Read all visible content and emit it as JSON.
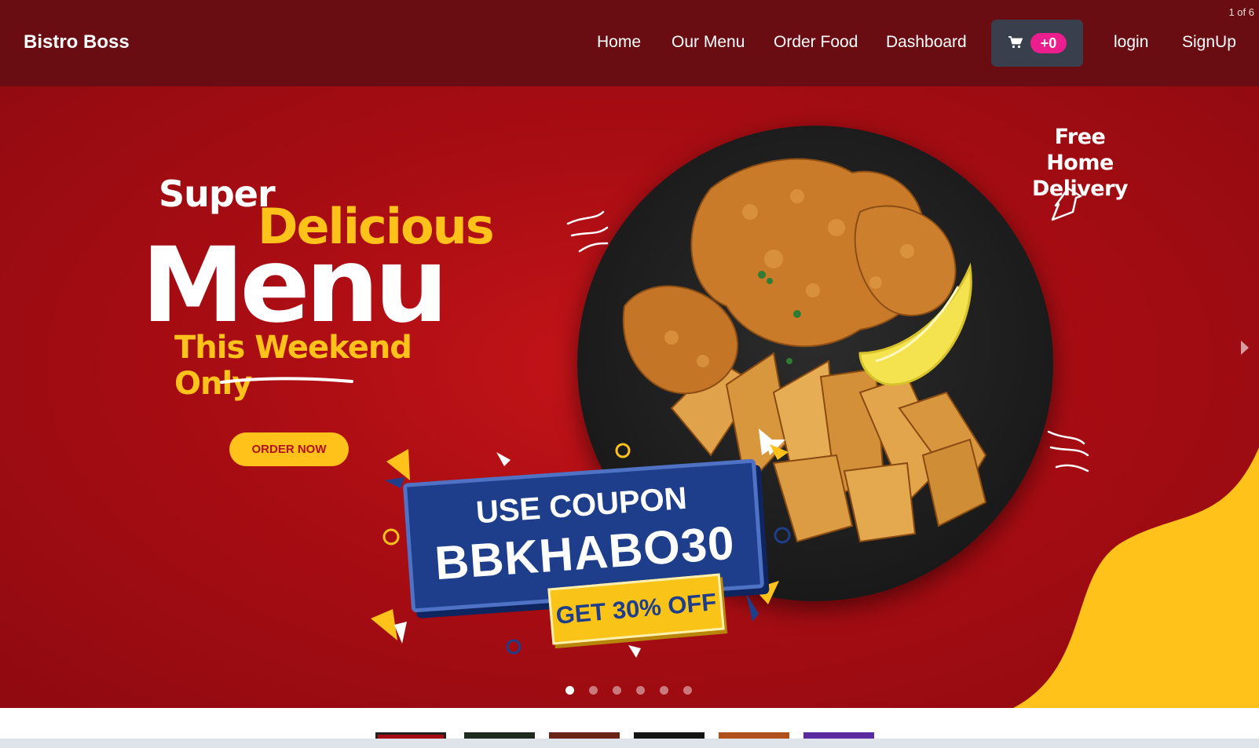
{
  "navbar": {
    "brand": "Bistro Boss",
    "links": [
      "Home",
      "Our Menu",
      "Order Food",
      "Dashboard"
    ],
    "cart": {
      "icon": "cart-icon",
      "count": "+0"
    },
    "login": "login",
    "signup": "SignUp"
  },
  "carousel": {
    "counter": "1 of 6",
    "slide": {
      "super": "Super",
      "delicious": "Delicious",
      "menu": "Menu",
      "weekend": "This Weekend Only",
      "order_button": "ORDER NOW",
      "coupon_line1": "USE COUPON",
      "coupon_code": "BBKHABO30",
      "discount": "GET 30% OFF",
      "delivery_line1": "Free Home",
      "delivery_line2": "Delivery"
    },
    "total_slides": 6,
    "active_slide": 1
  },
  "colors": {
    "navbar": "#6a0d13",
    "hero_red": "#a80d13",
    "accent_yellow": "#ffc21b",
    "coupon_blue": "#1e3e8c",
    "cart_badge": "#ec1d8c"
  }
}
